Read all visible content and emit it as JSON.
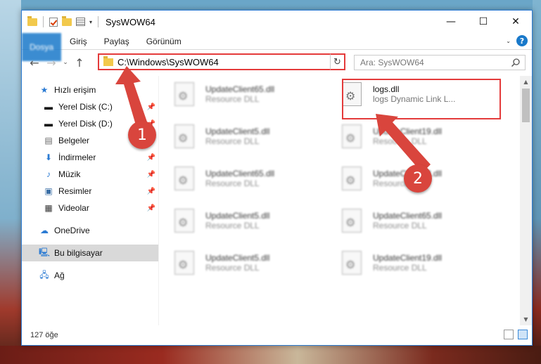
{
  "window": {
    "title": "SysWOW64",
    "controls": {
      "minimize": "—",
      "maximize": "☐",
      "close": "✕"
    }
  },
  "ribbon": {
    "tabs": [
      "Dosya",
      "Giriş",
      "Paylaş",
      "Görünüm"
    ],
    "help": "?"
  },
  "navigation": {
    "address": "C:\\Windows\\SysWOW64",
    "search_placeholder": "Ara: SysWOW64"
  },
  "sidebar": {
    "items": [
      {
        "label": "Hızlı erişim",
        "icon": "star-icon"
      },
      {
        "label": "Yerel Disk (C:)",
        "icon": "drive-icon",
        "pinned": true
      },
      {
        "label": "Yerel Disk (D:)",
        "icon": "drive-icon",
        "pinned": true
      },
      {
        "label": "Belgeler",
        "icon": "documents-icon",
        "pinned": true
      },
      {
        "label": "İndirmeler",
        "icon": "download-icon",
        "pinned": true
      },
      {
        "label": "Müzik",
        "icon": "music-icon",
        "pinned": true
      },
      {
        "label": "Resimler",
        "icon": "pictures-icon",
        "pinned": true
      },
      {
        "label": "Videolar",
        "icon": "videos-icon",
        "pinned": true
      },
      {
        "label": "OneDrive",
        "icon": "cloud-icon"
      },
      {
        "label": "Bu bilgisayar",
        "icon": "computer-icon",
        "selected": true
      },
      {
        "label": "Ağ",
        "icon": "network-icon"
      }
    ]
  },
  "files": [
    {
      "name": "UpdateClient65.dll",
      "desc": "Resource DLL"
    },
    {
      "name": "logs.dll",
      "desc": "logs Dynamic Link L...",
      "highlighted": true
    },
    {
      "name": "UpdateClient5.dll",
      "desc": "Resource DLL"
    },
    {
      "name": "UpdateClient19.dll",
      "desc": "Resource DLL"
    },
    {
      "name": "UpdateClient65.dll",
      "desc": "Resource DLL"
    },
    {
      "name": "UpdateClient63.dll",
      "desc": "Resource DLL"
    },
    {
      "name": "UpdateClient5.dll",
      "desc": "Resource DLL"
    },
    {
      "name": "UpdateClient65.dll",
      "desc": "Resource DLL"
    },
    {
      "name": "UpdateClient5.dll",
      "desc": "Resource DLL"
    },
    {
      "name": "UpdateClient19.dll",
      "desc": "Resource DLL"
    }
  ],
  "status": {
    "item_count": "127 öğe"
  },
  "annotations": {
    "badge1": "1",
    "badge2": "2",
    "color": "#d9453d"
  }
}
